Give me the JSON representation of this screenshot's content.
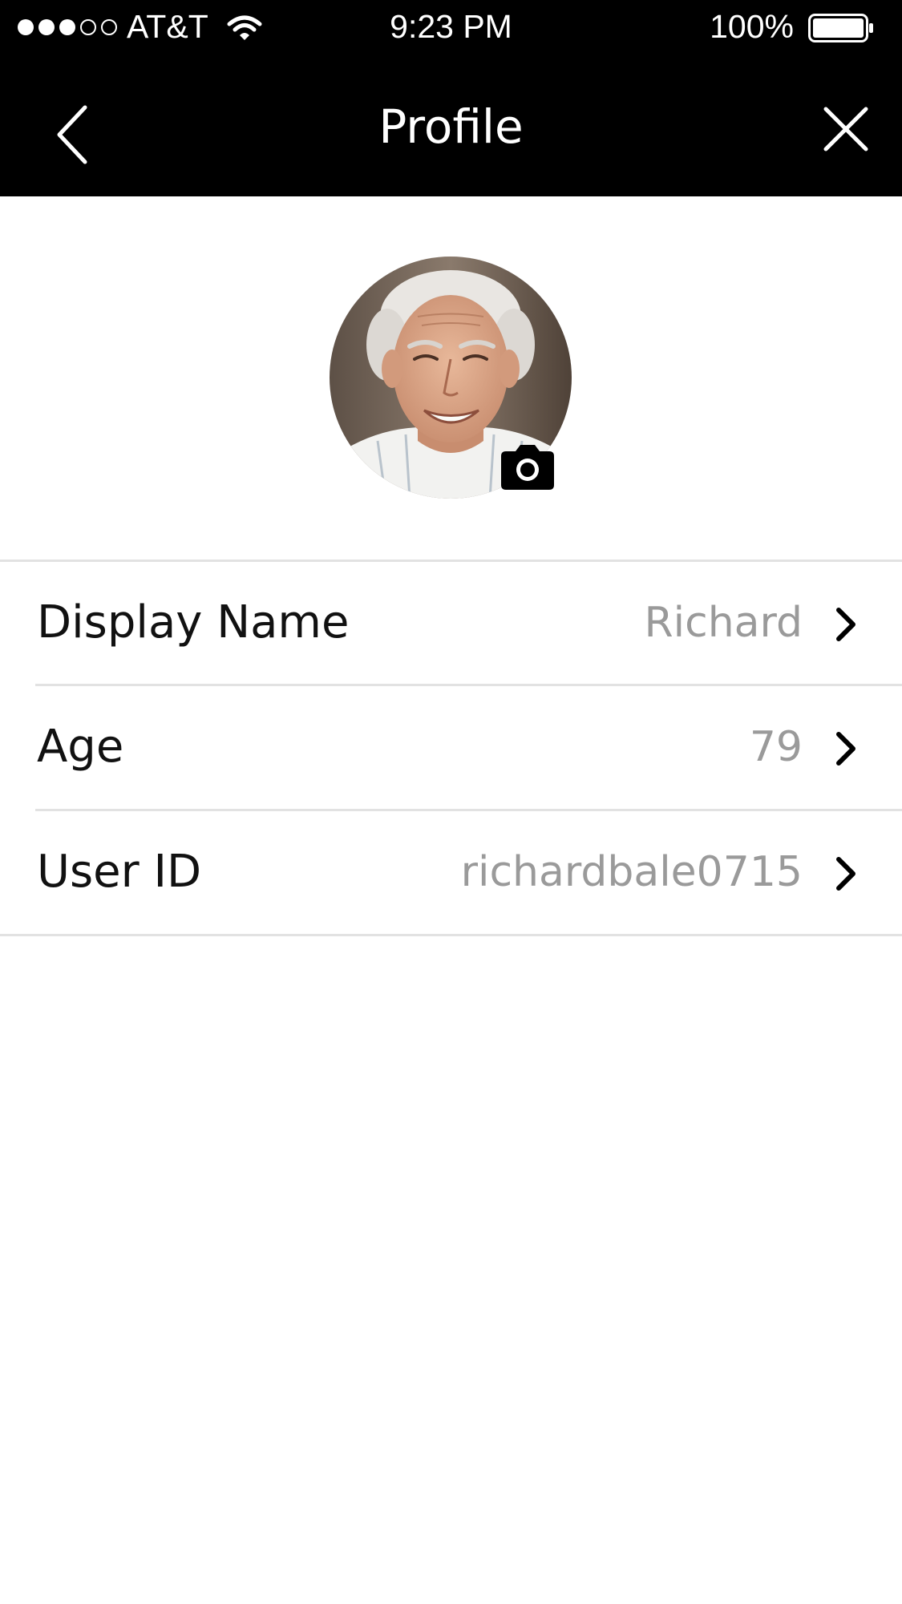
{
  "status_bar": {
    "carrier": "AT&T",
    "time": "9:23 PM",
    "battery_percent": "100%",
    "signal_bars_filled": 3,
    "signal_bars_total": 5,
    "icons": [
      "signal-dots-icon",
      "wifi-icon",
      "battery-icon"
    ]
  },
  "nav": {
    "title": "Profile",
    "back_icon": "chevron-left-icon",
    "close_icon": "close-icon"
  },
  "profile": {
    "avatar_icon": "avatar-photo",
    "camera_icon": "camera-icon"
  },
  "rows": [
    {
      "label": "Display Name",
      "value": "Richard"
    },
    {
      "label": "Age",
      "value": "79"
    },
    {
      "label": "User ID",
      "value": "richardbale0715"
    }
  ],
  "colors": {
    "bar_background": "#000000",
    "value_text": "#9a9a9a",
    "divider": "#e2e2e2"
  }
}
